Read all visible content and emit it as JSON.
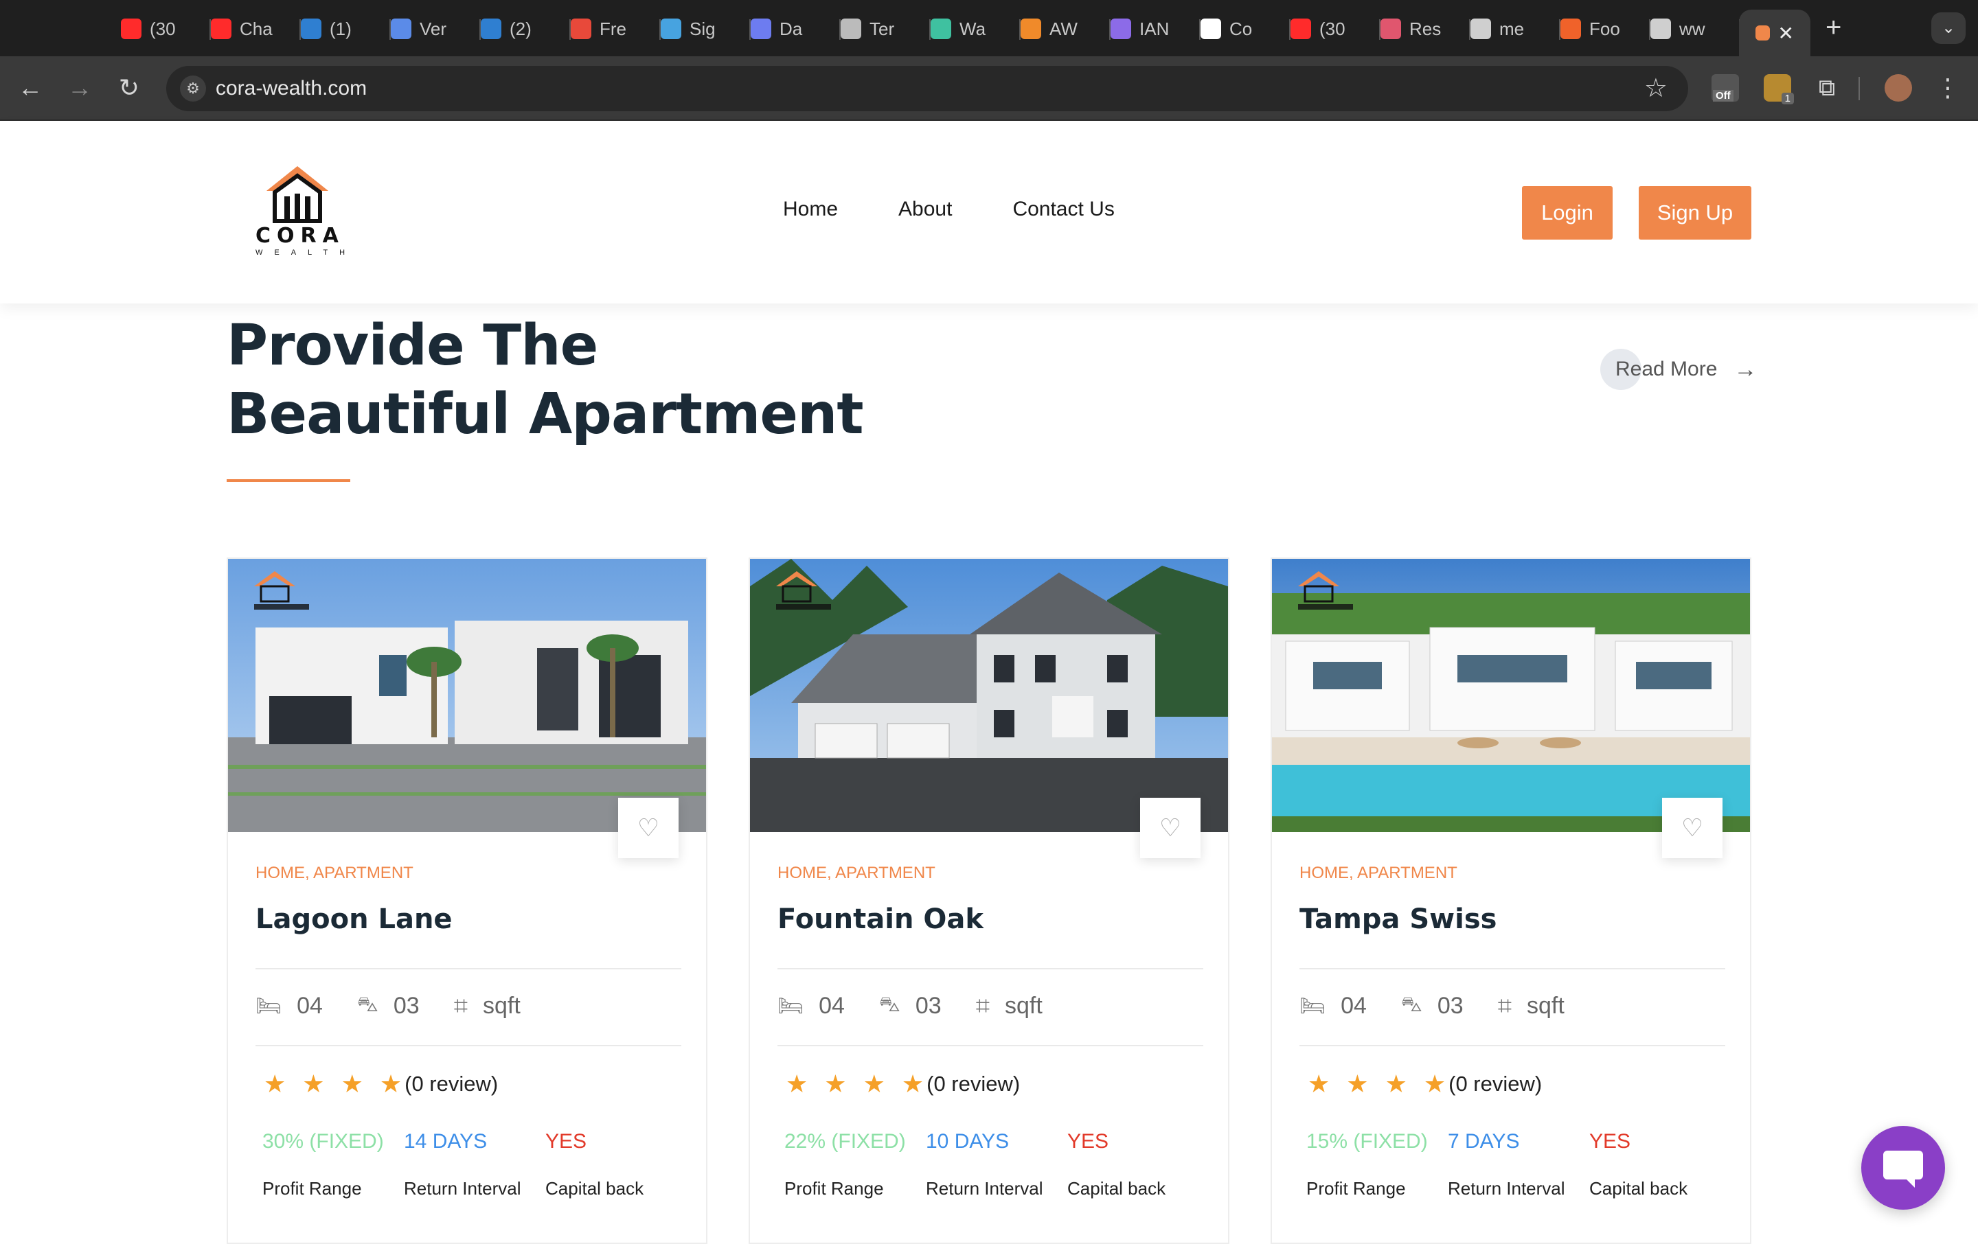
{
  "browser": {
    "tabs": [
      {
        "label": "(30",
        "icon": "youtube-icon",
        "color": "#ff2b2b"
      },
      {
        "label": "Cha",
        "icon": "youtube-icon",
        "color": "#ff2b2b"
      },
      {
        "label": "(1)",
        "icon": "linkedin-icon",
        "color": "#2f7fd1"
      },
      {
        "label": "Ver",
        "icon": "linkedin-outline-icon",
        "color": "#5b8be8"
      },
      {
        "label": "(2)",
        "icon": "linkedin-icon",
        "color": "#2f7fd1"
      },
      {
        "label": "Fre",
        "icon": "gmail-icon",
        "color": "#e8493a"
      },
      {
        "label": "Sig",
        "icon": "eye-icon",
        "color": "#47a3e0"
      },
      {
        "label": "Da",
        "icon": "music-icon",
        "color": "#6d7cf0"
      },
      {
        "label": "Ter",
        "icon": "globe-icon",
        "color": "#bbbbbb"
      },
      {
        "label": "Wa",
        "icon": "s-icon",
        "color": "#3fc1a0"
      },
      {
        "label": "AW",
        "icon": "cube-icon",
        "color": "#f08a2a"
      },
      {
        "label": "IAN",
        "icon": "iam-icon",
        "color": "#8c6be8"
      },
      {
        "label": "Co",
        "icon": "chatgpt-icon",
        "color": "#ffffff"
      },
      {
        "label": "(30",
        "icon": "youtube-icon",
        "color": "#ff2b2b"
      },
      {
        "label": "Res",
        "icon": "tag-icon",
        "color": "#e0566e"
      },
      {
        "label": "me",
        "icon": "github-icon",
        "color": "#cfcfcf"
      },
      {
        "label": "Foo",
        "icon": "ls-icon",
        "color": "#f0622a"
      },
      {
        "label": "ww",
        "icon": "openai-icon",
        "color": "#cfcfcf"
      }
    ],
    "url": "cora-wealth.com",
    "extension_badge": "Off",
    "extension_count": "1"
  },
  "site": {
    "logo_word": "CORA",
    "logo_sub": "WEALTH",
    "nav": [
      "Home",
      "About",
      "Contact Us"
    ],
    "login": "Login",
    "signup": "Sign Up",
    "accent": "#f0874a"
  },
  "hero": {
    "title_line1": "Provide The",
    "title_line2": "Beautiful Apartment",
    "read_more": "Read More"
  },
  "cards": [
    {
      "category": "HOME, APARTMENT",
      "title": "Lagoon Lane",
      "beds": "04",
      "baths": "03",
      "area": "sqft",
      "rating": 4,
      "reviews": "(0 review)",
      "profit": "30% (FIXED)",
      "interval": "14 DAYS",
      "capital": "YES",
      "profit_label": "Profit Range",
      "interval_label": "Return Interval",
      "capital_label": "Capital back"
    },
    {
      "category": "HOME, APARTMENT",
      "title": "Fountain Oak",
      "beds": "04",
      "baths": "03",
      "area": "sqft",
      "rating": 4,
      "reviews": "(0 review)",
      "profit": "22% (FIXED)",
      "interval": "10 DAYS",
      "capital": "YES",
      "profit_label": "Profit Range",
      "interval_label": "Return Interval",
      "capital_label": "Capital back"
    },
    {
      "category": "HOME, APARTMENT",
      "title": "Tampa Swiss",
      "beds": "04",
      "baths": "03",
      "area": "sqft",
      "rating": 4,
      "reviews": "(0 review)",
      "profit": "15% (FIXED)",
      "interval": "7 DAYS",
      "capital": "YES",
      "profit_label": "Profit Range",
      "interval_label": "Return Interval",
      "capital_label": "Capital back"
    }
  ],
  "colors": {
    "profit": "#8de0a6",
    "interval": "#3d8ee8",
    "capital": "#e23a2a"
  }
}
